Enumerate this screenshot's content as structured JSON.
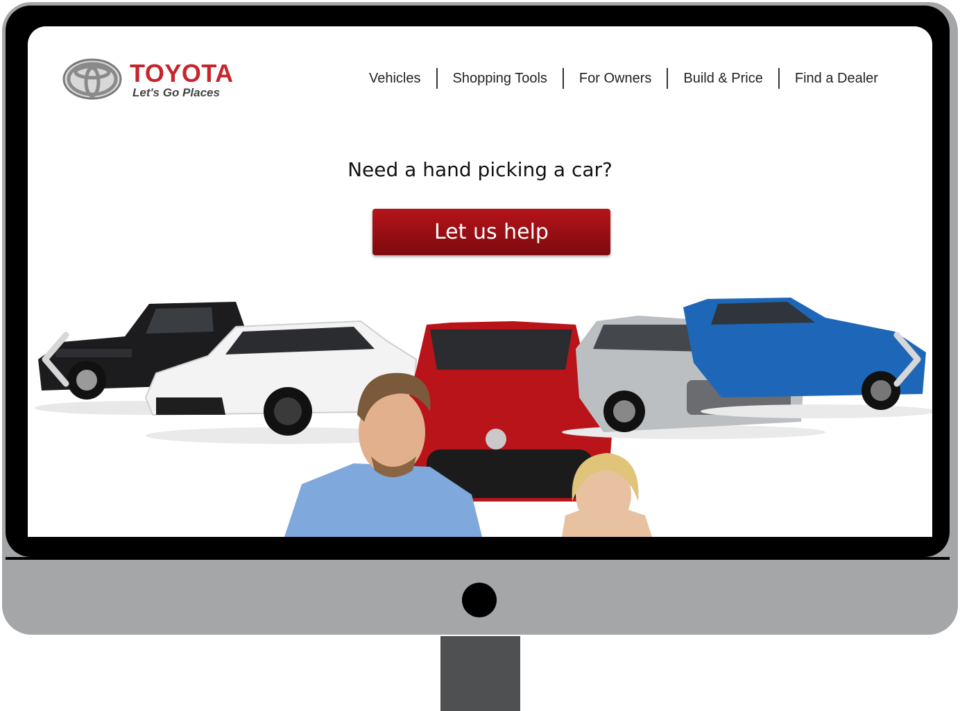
{
  "brand": {
    "name": "TOYOTA",
    "tagline": "Let's Go Places"
  },
  "nav": {
    "items": [
      {
        "label": "Vehicles"
      },
      {
        "label": "Shopping Tools"
      },
      {
        "label": "For Owners"
      },
      {
        "label": "Build & Price"
      },
      {
        "label": "Find a Dealer"
      }
    ]
  },
  "hero": {
    "headline": "Need a hand picking a car?",
    "cta_label": "Let us help"
  },
  "carousel": {
    "vehicles": [
      {
        "name": "black-pickup-truck",
        "color": "#1c1c1e"
      },
      {
        "name": "white-sedan",
        "color": "#f2f2f2"
      },
      {
        "name": "red-sedan",
        "color": "#b8141a"
      },
      {
        "name": "silver-sedan",
        "color": "#b9bcbf"
      },
      {
        "name": "blue-suv",
        "color": "#1e67b8"
      }
    ]
  },
  "colors": {
    "brand_red": "#c8242b",
    "cta_red": "#a31217",
    "monitor_gray": "#a4a6a8",
    "stand_gray": "#4f5052"
  }
}
